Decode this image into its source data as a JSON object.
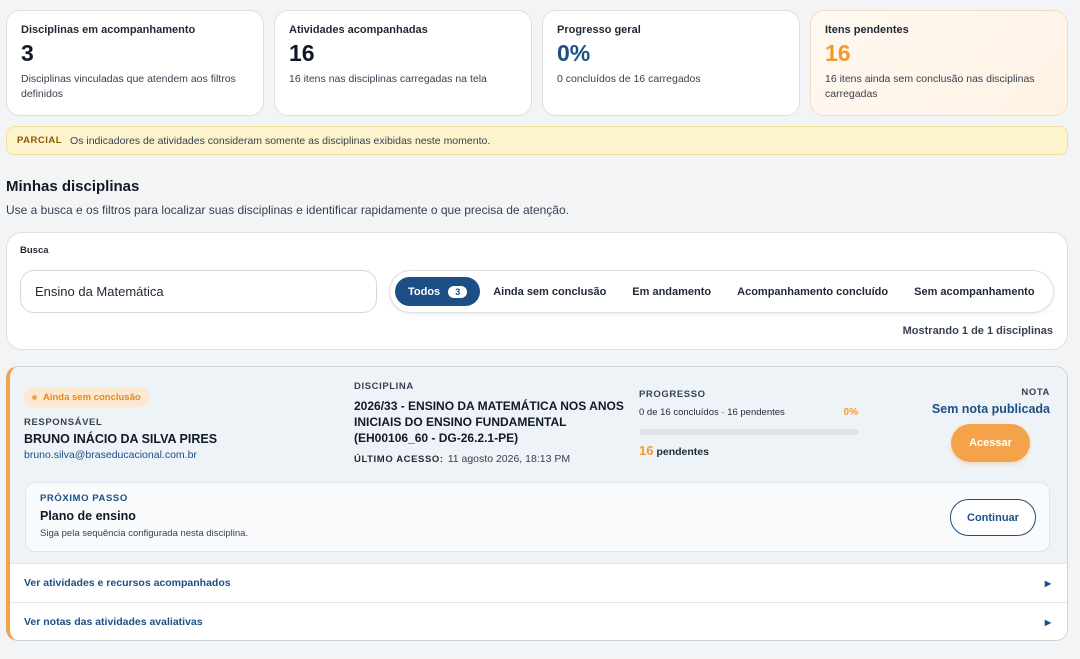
{
  "stats": [
    {
      "label": "Disciplinas em acompanhamento",
      "value": "3",
      "desc": "Disciplinas vinculadas que atendem aos filtros definidos"
    },
    {
      "label": "Atividades acompanhadas",
      "value": "16",
      "desc": "16 itens nas disciplinas carregadas na tela"
    },
    {
      "label": "Progresso geral",
      "value": "0%",
      "desc": "0 concluídos de 16 carregados"
    },
    {
      "label": "Itens pendentes",
      "value": "16",
      "desc": "16 itens ainda sem conclusão nas disciplinas carregadas"
    }
  ],
  "notice": {
    "tag": "PARCIAL",
    "text": "Os indicadores de atividades consideram somente as disciplinas exibidas neste momento."
  },
  "section": {
    "title": "Minhas disciplinas",
    "subtitle": "Use a busca e os filtros para localizar suas disciplinas e identificar rapidamente o que precisa de atenção."
  },
  "search": {
    "label": "Busca",
    "value": "Ensino da Matemática",
    "filters": [
      {
        "label": "Todos",
        "count": "3"
      },
      {
        "label": "Ainda sem conclusão"
      },
      {
        "label": "Em andamento"
      },
      {
        "label": "Acompanhamento concluído"
      },
      {
        "label": "Sem acompanhamento"
      }
    ],
    "showing": "Mostrando 1 de 1 disciplinas"
  },
  "course": {
    "status": "Ainda sem conclusão",
    "responsible_label": "RESPONSÁVEL",
    "responsible_name": "BRUNO INÁCIO DA SILVA PIRES",
    "responsible_email": "bruno.silva@braseducacional.com.br",
    "discipline_label": "DISCIPLINA",
    "discipline_name": "2026/33 - ENSINO DA MATEMÁTICA NOS ANOS INICIAIS DO ENSINO FUNDAMENTAL (EH00106_60 - DG-26.2.1-PE)",
    "last_access_label": "ÚLTIMO ACESSO:",
    "last_access_value": "11 agosto 2026, 18:13 PM",
    "progress_label": "PROGRESSO",
    "progress_summary": "0 de 16 concluídos · 16 pendentes",
    "progress_percent_text": "0%",
    "progress_fraction": 0,
    "pending_count": "16",
    "pending_label": "pendentes",
    "grade_label": "NOTA",
    "grade_value": "Sem nota publicada",
    "access_button": "Acessar",
    "next_step": {
      "label": "PRÓXIMO PASSO",
      "title": "Plano de ensino",
      "desc": "Siga pela sequência configurada nesta disciplina.",
      "button": "Continuar"
    },
    "expand_rows": [
      {
        "label": "Ver atividades e recursos acompanhados"
      },
      {
        "label": "Ver notas das atividades avaliativas"
      }
    ]
  },
  "colors": {
    "primary": "#1c4f86",
    "accent": "#f39a2c",
    "notice_bg": "#fdf4cd"
  },
  "icons": {
    "caret": "caret-right-icon",
    "status_dot": "status-dot-icon"
  }
}
